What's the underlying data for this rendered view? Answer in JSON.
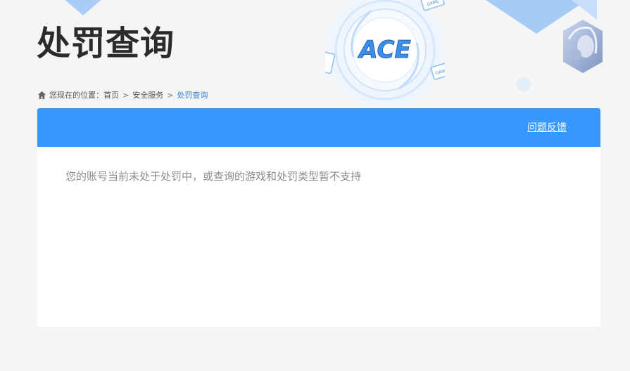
{
  "page": {
    "title": "处罚查询"
  },
  "breadcrumb": {
    "prefix": "您现在的位置：",
    "items": [
      "首页",
      "安全服务"
    ],
    "separator": ">",
    "current": "处罚查询"
  },
  "panel": {
    "feedback_link": "问题反馈",
    "message": "您的账号当前未处于处罚中，或查询的游戏和处罚类型暂不支持"
  },
  "banner": {
    "logo_text": "ACE",
    "game_tag": "GAME"
  },
  "colors": {
    "accent": "#3897fd",
    "current_crumb": "#2e7fce",
    "title": "#2b2b2b",
    "message": "#8b8b8b",
    "background": "#f5f5f6"
  }
}
